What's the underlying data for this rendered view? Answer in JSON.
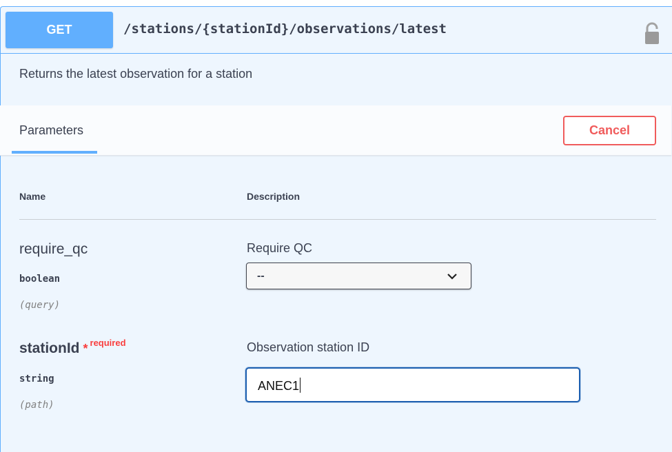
{
  "operation": {
    "method": "GET",
    "path": "/stations/{stationId}/observations/latest",
    "description": "Returns the latest observation for a station",
    "lock_icon": "unlocked-padlock-icon"
  },
  "section": {
    "tab_label": "Parameters",
    "cancel_label": "Cancel"
  },
  "table": {
    "headers": {
      "name": "Name",
      "description": "Description"
    }
  },
  "parameters": [
    {
      "name": "require_qc",
      "type": "boolean",
      "in": "(query)",
      "description": "Require QC",
      "control": "select",
      "value": "--"
    },
    {
      "name": "stationId",
      "required_star": "*",
      "required_label": "required",
      "type": "string",
      "in": "(path)",
      "description": "Observation station ID",
      "control": "input",
      "value": "ANEC1"
    }
  ],
  "colors": {
    "accent": "#61affe",
    "cancel": "#f05b5b",
    "required": "#f93e3e",
    "background": "#eef6fe"
  }
}
